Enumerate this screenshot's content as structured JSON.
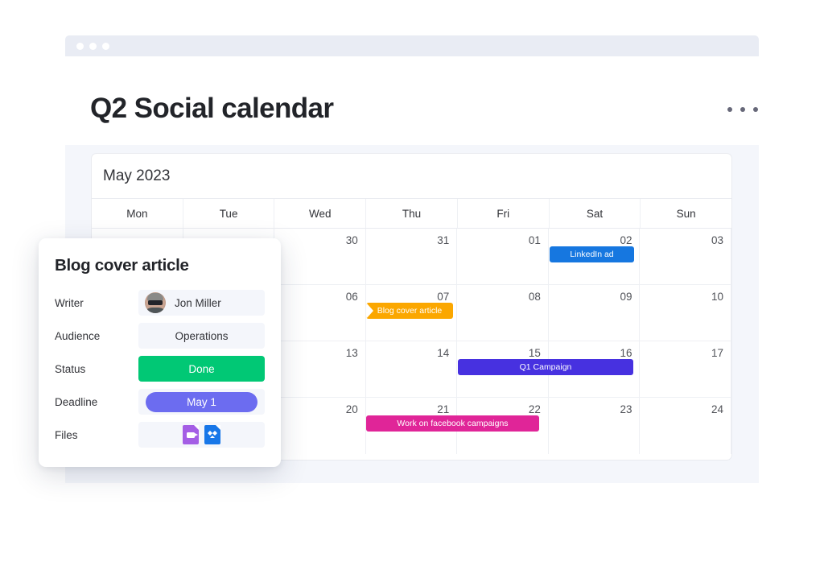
{
  "window": {
    "dots": [
      "dot-1",
      "dot-2",
      "dot-3"
    ]
  },
  "header": {
    "title": "Q2 Social calendar",
    "menu_icon": "kebab-menu-icon"
  },
  "calendar": {
    "month_label": "May 2023",
    "weekdays": [
      "Mon",
      "Tue",
      "Wed",
      "Thu",
      "Fri",
      "Sat",
      "Sun"
    ],
    "weeks": [
      {
        "days": [
          "",
          "",
          "30",
          "31",
          "01",
          "02",
          "03"
        ]
      },
      {
        "days": [
          "",
          "",
          "06",
          "07",
          "08",
          "09",
          "10"
        ]
      },
      {
        "days": [
          "",
          "",
          "13",
          "14",
          "15",
          "16",
          "17"
        ]
      },
      {
        "days": [
          "",
          "",
          "20",
          "21",
          "22",
          "23",
          "24"
        ]
      }
    ],
    "events": [
      {
        "label": "LinkedIn ad",
        "color": "#1677e0",
        "week": 0,
        "start_day": "Fri",
        "span": 1
      },
      {
        "label": "Blog cover article",
        "color": "#fba700",
        "week": 1,
        "start_day": "Tue",
        "span": 1
      },
      {
        "label": "Q1 Campaign",
        "color": "#4731e0",
        "week": 2,
        "start_day": "Wed",
        "span": 3
      },
      {
        "label": "Work on facebook campaigns",
        "color": "#e02598",
        "week": 3,
        "start_day": "Tue",
        "span": 2
      }
    ]
  },
  "detail_card": {
    "title": "Blog cover article",
    "fields": [
      {
        "label": "Writer",
        "value": "Jon Miller",
        "type": "person"
      },
      {
        "label": "Audience",
        "value": "Operations",
        "type": "text"
      },
      {
        "label": "Status",
        "value": "Done",
        "type": "status",
        "color": "#01c875"
      },
      {
        "label": "Deadline",
        "value": "May 1",
        "type": "date",
        "color": "#6c6cf0"
      },
      {
        "label": "Files",
        "value": "",
        "type": "files"
      }
    ],
    "files": [
      {
        "name": "video-file-icon",
        "color": "#a45ee5"
      },
      {
        "name": "dropbox-file-icon",
        "color": "#1877e8"
      }
    ],
    "avatar_name": "avatar"
  },
  "colors": {
    "accent_blue": "#1677e0",
    "accent_orange": "#fba700",
    "accent_purple": "#4731e0",
    "accent_pink": "#e02598",
    "status_green": "#01c875",
    "date_purple": "#6c6cf0",
    "panel_bg": "#f4f6fb",
    "chrome_bg": "#e9ecf4"
  }
}
